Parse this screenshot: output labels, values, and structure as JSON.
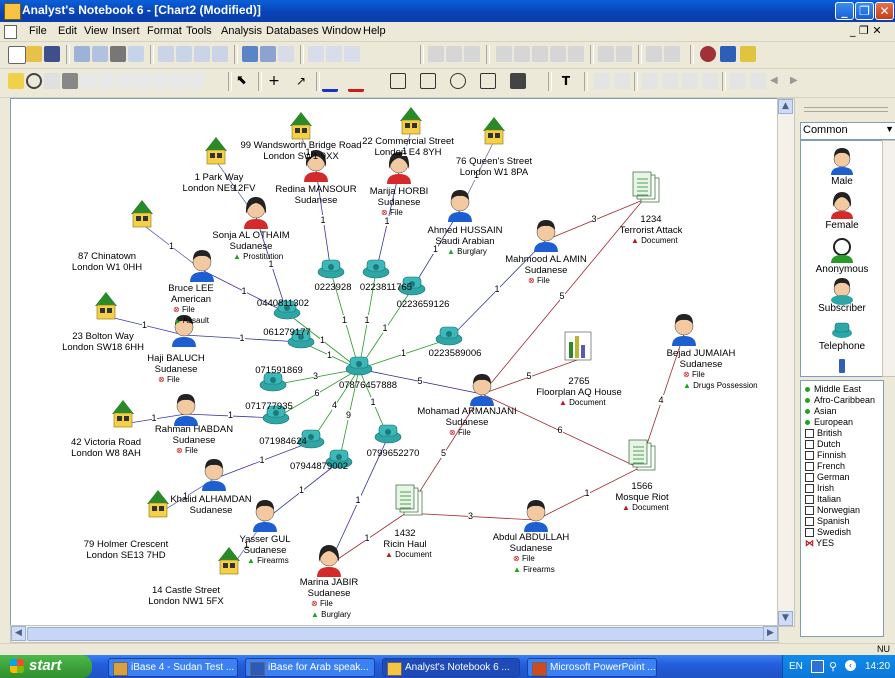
{
  "window": {
    "title": "Analyst's Notebook 6 - [Chart2 (Modified)]"
  },
  "menu": [
    "File",
    "Edit",
    "View",
    "Insert",
    "Format",
    "Tools",
    "Analysis",
    "Databases",
    "Window",
    "Help"
  ],
  "palette": {
    "combo_value": "Common",
    "icons": [
      "Male",
      "Female",
      "Anonymous",
      "Subscriber",
      "Telephone"
    ],
    "legend_dots": [
      {
        "label": "Middle East",
        "color": "#1aa51a"
      },
      {
        "label": "Afro-Caribbean",
        "color": "#1aa51a"
      },
      {
        "label": "Asian",
        "color": "#1aa51a"
      },
      {
        "label": "European",
        "color": "#1aa51a"
      }
    ],
    "legend_checks": [
      "British",
      "Dutch",
      "Finnish",
      "French",
      "German",
      "Irish",
      "Italian",
      "Norwegian",
      "Spanish",
      "Swedish"
    ],
    "legend_yes": "YES"
  },
  "status": {
    "indicator": "NU"
  },
  "taskbar": {
    "start": "start",
    "tasks": [
      "iBase 4 - Sudan Test ...",
      "iBase for Arab speak...",
      "Analyst's Notebook 6 ...",
      "Microsoft PowerPoint ..."
    ],
    "lang": "EN",
    "clock": "14:20"
  },
  "chart": {
    "houses": [
      {
        "l1": "99 Wandsworth Bridge Road",
        "l2": "London  SW1 9XX"
      },
      {
        "l1": "22 Commercial Street",
        "l2": "London  E4 8YH"
      },
      {
        "l1": "76 Queen's Street",
        "l2": "London  W1 8PA"
      },
      {
        "l1": "1 Park Way",
        "l2": "London  NE9 2FV"
      },
      {
        "l1": "87 Chinatown",
        "l2": "London  W1 0HH"
      },
      {
        "l1": "23 Bolton Way",
        "l2": "London  SW18 6HH"
      },
      {
        "l1": "42 Victoria Road",
        "l2": "London  W8 8AH"
      },
      {
        "l1": "79 Holmer Crescent",
        "l2": "London  SE13 7HD"
      },
      {
        "l1": "14 Castle Street",
        "l2": "London  NW1 5FX"
      }
    ],
    "people": [
      {
        "name": "Redina MANSOUR",
        "nat": "Sudanese",
        "attrs": []
      },
      {
        "name": "Marija HORBI",
        "nat": "Sudanese",
        "attrs": [
          "File"
        ]
      },
      {
        "name": "Ahmed HUSSAIN",
        "nat": "Saudi Arabian",
        "attrs": [
          "Burglary"
        ]
      },
      {
        "name": "Sonja AL OTHAIM",
        "nat": "Sudanese",
        "attrs": [
          "Prostitution"
        ]
      },
      {
        "name": "Mahmood AL AMIN",
        "nat": "Sudanese",
        "attrs": [
          "File"
        ]
      },
      {
        "name": "Bruce LEE",
        "nat": "American",
        "attrs": [
          "File",
          "Assault"
        ]
      },
      {
        "name": "Haji BALUCH",
        "nat": "Sudanese",
        "attrs": [
          "File"
        ]
      },
      {
        "name": "Bejad JUMAIAH",
        "nat": "Sudanese",
        "attrs": [
          "File",
          "Drugs Possession"
        ]
      },
      {
        "name": "Mohamad ARMANJANI",
        "nat": "Sudanese",
        "attrs": [
          "File"
        ]
      },
      {
        "name": "Rahman HABDAN",
        "nat": "Sudanese",
        "attrs": [
          "File"
        ]
      },
      {
        "name": "Khalid ALHAMDAN",
        "nat": "Sudanese",
        "attrs": []
      },
      {
        "name": "Yasser GUL",
        "nat": "Sudanese",
        "attrs": [
          "Firearms"
        ]
      },
      {
        "name": "Abdul ABDULLAH",
        "nat": "Sudanese",
        "attrs": [
          "File",
          "Firearms"
        ]
      },
      {
        "name": "Marina JABIR",
        "nat": "Sudanese",
        "attrs": [
          "File",
          "Burglary"
        ]
      }
    ],
    "phones": [
      "0223928",
      "0223811765",
      "0223659126",
      "0440811302",
      "061279177",
      "0223589006",
      "071591869",
      "07876457888",
      "071777935",
      "071984624",
      "07944879002",
      "0799652270"
    ],
    "documents": [
      {
        "id": "1234",
        "title": "Terrorist Attack",
        "type": "Document"
      },
      {
        "id": "2765",
        "title": "Floorplan AQ House",
        "type": "Document"
      },
      {
        "id": "1566",
        "title": "Mosque Riot",
        "type": "Document"
      },
      {
        "id": "1432",
        "title": "Ricin Haul",
        "type": "Document"
      }
    ],
    "link_labels": [
      "1",
      "1",
      "1",
      "1",
      "1",
      "1",
      "1",
      "1",
      "1",
      "1",
      "1",
      "1",
      "1",
      "1",
      "1",
      "1",
      "1",
      "1",
      "1",
      "1",
      "1",
      "1",
      "1",
      "1",
      "1",
      "1",
      "3",
      "6",
      "4",
      "9",
      "5",
      "3",
      "5",
      "5",
      "6",
      "5",
      "4",
      "3",
      "1",
      "1",
      "1",
      "1"
    ]
  }
}
